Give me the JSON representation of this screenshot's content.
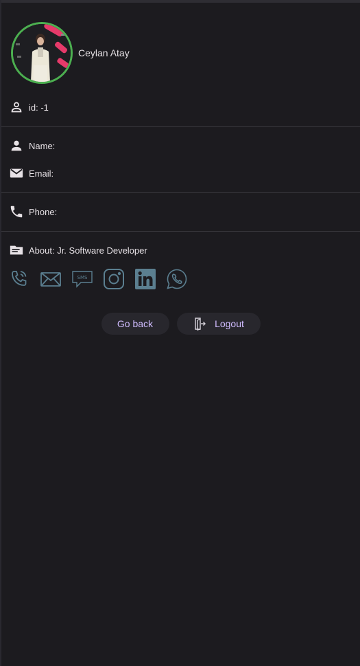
{
  "profile": {
    "name": "Ceylan Atay",
    "ring_color": "#4caf50"
  },
  "fields": {
    "id": "id: -1",
    "name": "Name:",
    "email": "Email:",
    "phone": "Phone:",
    "about": "About: Jr. Software Developer"
  },
  "icons": {
    "id": "person-outline-icon",
    "name": "person-icon",
    "email": "mail-icon",
    "phone": "phone-icon",
    "about": "description-icon"
  },
  "socials": [
    "phone-call-icon",
    "email-icon",
    "sms-icon",
    "instagram-icon",
    "linkedin-icon",
    "whatsapp-icon"
  ],
  "sms_label": "SMS",
  "buttons": {
    "back": "Go back",
    "logout": "Logout"
  },
  "colors": {
    "background": "#1c1b1f",
    "social_icon": "#5b7f90",
    "button_text": "#d0bcff"
  }
}
